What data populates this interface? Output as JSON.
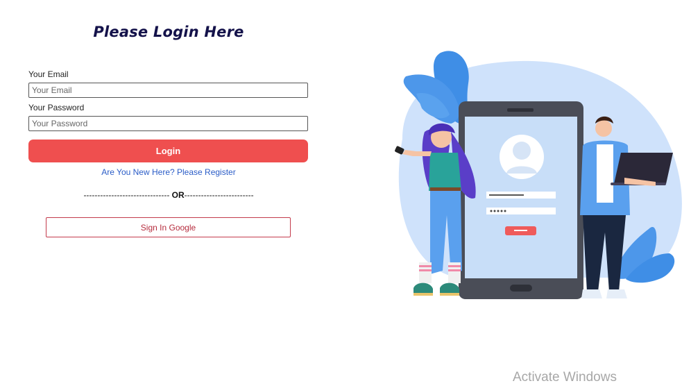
{
  "page": {
    "title": "Please Login Here"
  },
  "form": {
    "email_label": "Your Email",
    "email_placeholder": "Your Email",
    "password_label": "Your Password",
    "password_placeholder": "Your Password",
    "login_label": "Login",
    "register_link": "Are You New Here? Please Register",
    "or_left": "------------------------------- ",
    "or_word": "OR",
    "or_right": "-------------------------",
    "google_label": "Sign In Google"
  },
  "colors": {
    "primary": "#ef4f4f",
    "link": "#2a5cc7",
    "title": "#14124a",
    "google_border": "#c33a4b"
  },
  "illustration": {
    "icons": [
      "phone-login-illustration",
      "user-avatar-icon",
      "woman-with-phone",
      "man-with-laptop",
      "leaf-decoration"
    ]
  },
  "watermark": {
    "text": "Activate Windows"
  }
}
